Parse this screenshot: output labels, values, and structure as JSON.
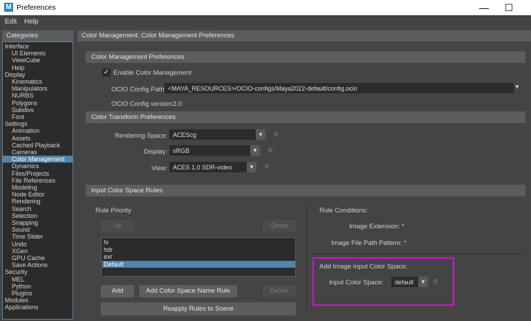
{
  "window": {
    "title": "Preferences",
    "logo": "M",
    "minimize": "—",
    "maximize": "☐"
  },
  "menubar": {
    "edit": "Edit",
    "help": "Help"
  },
  "categories": {
    "header": "Categories",
    "items": [
      {
        "label": "Interface",
        "level": 0
      },
      {
        "label": "UI Elements",
        "level": 1
      },
      {
        "label": "ViewCube",
        "level": 1
      },
      {
        "label": "Help",
        "level": 1
      },
      {
        "label": "Display",
        "level": 0
      },
      {
        "label": "Kinematics",
        "level": 1
      },
      {
        "label": "Manipulators",
        "level": 1
      },
      {
        "label": "NURBS",
        "level": 1
      },
      {
        "label": "Polygons",
        "level": 1
      },
      {
        "label": "Subdivs",
        "level": 1
      },
      {
        "label": "Font",
        "level": 1
      },
      {
        "label": "Settings",
        "level": 0
      },
      {
        "label": "Animation",
        "level": 1
      },
      {
        "label": "Assets",
        "level": 1
      },
      {
        "label": "Cached Playback",
        "level": 1
      },
      {
        "label": "Cameras",
        "level": 1
      },
      {
        "label": "Color Management",
        "level": 1,
        "selected": true
      },
      {
        "label": "Dynamics",
        "level": 1
      },
      {
        "label": "Files/Projects",
        "level": 1
      },
      {
        "label": "File References",
        "level": 1
      },
      {
        "label": "Modeling",
        "level": 1
      },
      {
        "label": "Node Editor",
        "level": 1
      },
      {
        "label": "Rendering",
        "level": 1
      },
      {
        "label": "Search",
        "level": 1
      },
      {
        "label": "Selection",
        "level": 1
      },
      {
        "label": "Snapping",
        "level": 1
      },
      {
        "label": "Sound",
        "level": 1
      },
      {
        "label": "Time Slider",
        "level": 1
      },
      {
        "label": "Undo",
        "level": 1
      },
      {
        "label": "XGen",
        "level": 1
      },
      {
        "label": "GPU Cache",
        "level": 1
      },
      {
        "label": "Save Actions",
        "level": 1
      },
      {
        "label": "Security",
        "level": 0
      },
      {
        "label": "MEL",
        "level": 1
      },
      {
        "label": "Python",
        "level": 1
      },
      {
        "label": "Plugins",
        "level": 1
      },
      {
        "label": "Modules",
        "level": 0
      },
      {
        "label": "Applications",
        "level": 0
      }
    ]
  },
  "panel": {
    "title": "Color Management: Color Management Preferences",
    "cm_section": "Color Management Preferences",
    "enable_label": "Enable Color Management",
    "enable_checked": "✓",
    "ocio_path_label": "OCIO Config Path:",
    "ocio_path_value": "<MAYA_RESOURCES>/OCIO-configs/Maya2022-default/config.ocio",
    "ocio_version_label": "OCIO Config version:",
    "ocio_version_value": "2.0",
    "ct_section": "Color Transform Preferences",
    "rendering_space_label": "Rendering Space:",
    "rendering_space_value": "ACEScg",
    "display_label": "Display:",
    "display_value": "sRGB",
    "view_label": "View:",
    "view_value": "ACES 1.0 SDR-video",
    "rules_section": "Input Color Space Rules",
    "rule_priority_label": "Rule Priority",
    "up_label": "Up",
    "down_label": "Down",
    "rules": [
      "tx",
      "hdr",
      "exr",
      "Default"
    ],
    "selected_rule": "Default",
    "add_label": "Add",
    "add_name_rule_label": "Add Color Space Name Rule",
    "delete_label": "Delete",
    "reapply_label": "Reapply Rules to Scene",
    "rule_conditions_label": "Rule Conditions:",
    "image_ext_label": "Image Extension: *",
    "file_path_label": "Image File Path Pattern: *",
    "add_input_cs_label": "Add Image Input Color Space:",
    "input_cs_label": "Input Color Space:",
    "input_cs_value": "default",
    "dropdown_arrow": "▼",
    "gear_glyph": "☼"
  },
  "colors": {
    "highlight": "#d016d0",
    "selection": "#5283a9",
    "background": "#444444"
  }
}
